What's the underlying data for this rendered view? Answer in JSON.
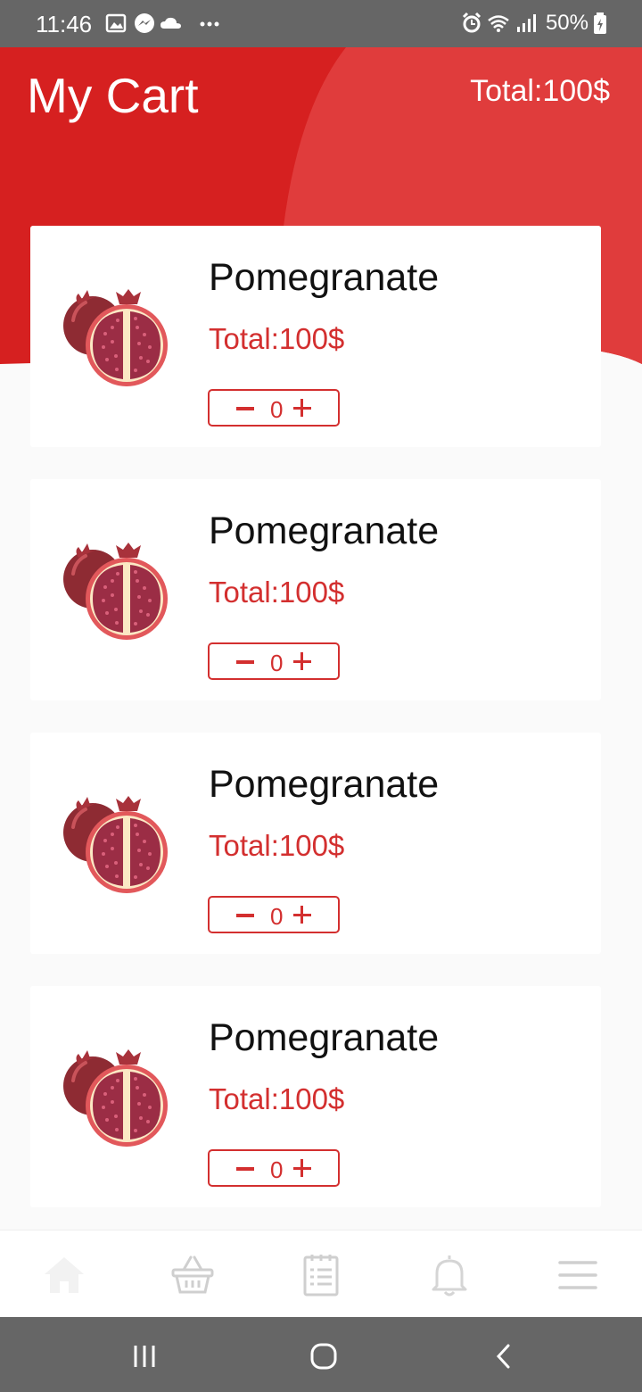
{
  "status_bar": {
    "time": "11:46",
    "battery": "50%",
    "left_icons": [
      "gallery-icon",
      "messenger-icon",
      "cloud-icon",
      "more-dots-icon"
    ],
    "right_icons": [
      "alarm-icon",
      "wifi-icon",
      "signal-icon",
      "battery-icon"
    ]
  },
  "header": {
    "title": "My Cart",
    "total": "Total:100$"
  },
  "colors": {
    "primary": "#d32f2f",
    "header_accent": "#e03c3c"
  },
  "cart_items": [
    {
      "name": "Pomegranate",
      "total": "Total:100$",
      "quantity": "0"
    },
    {
      "name": "Pomegranate",
      "total": "Total:100$",
      "quantity": "0"
    },
    {
      "name": "Pomegranate",
      "total": "Total:100$",
      "quantity": "0"
    },
    {
      "name": "Pomegranate",
      "total": "Total:100$",
      "quantity": "0"
    }
  ],
  "bottom_nav": [
    "home-icon",
    "basket-icon",
    "list-icon",
    "bell-icon",
    "menu-icon"
  ],
  "system_nav": [
    "recents-icon",
    "home-circle-icon",
    "back-icon"
  ]
}
